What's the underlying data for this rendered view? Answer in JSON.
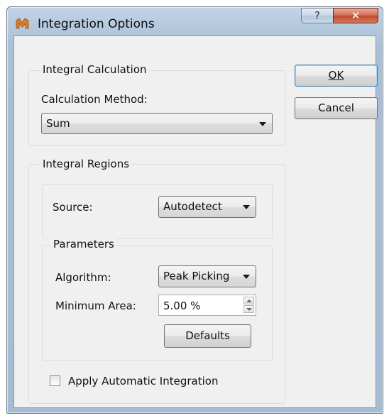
{
  "window": {
    "title": "Integration Options",
    "help_label": "?",
    "close_label": "✕"
  },
  "integral_calculation": {
    "label": "Integral Calculation",
    "method_label": "Calculation Method:",
    "method_value": "Sum"
  },
  "buttons": {
    "ok_label": "OK",
    "cancel_label": "Cancel",
    "defaults_label": "Defaults"
  },
  "integral_regions": {
    "label": "Integral Regions",
    "source_label": "Source:",
    "source_value": "Autodetect",
    "parameters": {
      "label": "Parameters",
      "algorithm_label": "Algorithm:",
      "algorithm_value": "Peak Picking",
      "min_area_label": "Minimum Area:",
      "min_area_value": "5.00 %"
    },
    "apply_auto_label": "Apply Automatic Integration",
    "apply_auto_checked": false
  },
  "colors": {
    "title_bar": "#b3c8dd",
    "close_button": "#c24a2f",
    "dialog_bg": "#f0f0f0",
    "default_button_border": "#3c7fb1"
  }
}
